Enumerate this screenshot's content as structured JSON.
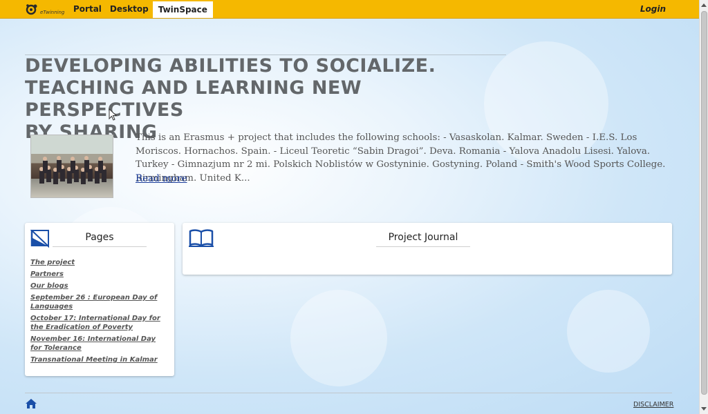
{
  "nav": {
    "logo_text": "eTwinning",
    "items": [
      {
        "label": "Portal"
      },
      {
        "label": "Desktop"
      },
      {
        "label": "TwinSpace"
      }
    ],
    "login_label": "Login"
  },
  "project": {
    "title_lines": [
      "DEVELOPING ABILITIES TO SOCIALIZE.",
      "TEACHING AND LEARNING NEW PERSPECTIVES",
      "BY SHARING"
    ],
    "description": "This is an Erasmus + project that includes the following schools: - Vasaskolan. Kalmar. Sweden - I.E.S. Los Moriscos. Hornachos. Spain. - Liceul Teoretic “Sabin Dragoi”. Deva. Romania - Yalova Anadolu Lisesi. Yalova. Turkey - Gimnazjum nr 2 mi. Polskich Noblistów w Gostyninie. Gostyning. Poland - Smith's Wood Sports College. Birmingham. United K...",
    "read_more_label": "Read more"
  },
  "pages_panel": {
    "title": "Pages",
    "items": [
      "The project",
      "Partners",
      "Our blogs",
      "September 26 : European Day of Languages",
      "October 17: International Day for the Eradication of Poverty",
      "November 16: International Day for Tolerance",
      "Transnational Meeting in Kalmar"
    ]
  },
  "journal_panel": {
    "title": "Project Journal"
  },
  "footer": {
    "disclaimer_label": "DISCLAIMER"
  },
  "colors": {
    "topbar": "#f5b800",
    "title_text": "#63676a",
    "link_blue": "#1a3c9a",
    "icon_blue": "#1a4fa8"
  }
}
